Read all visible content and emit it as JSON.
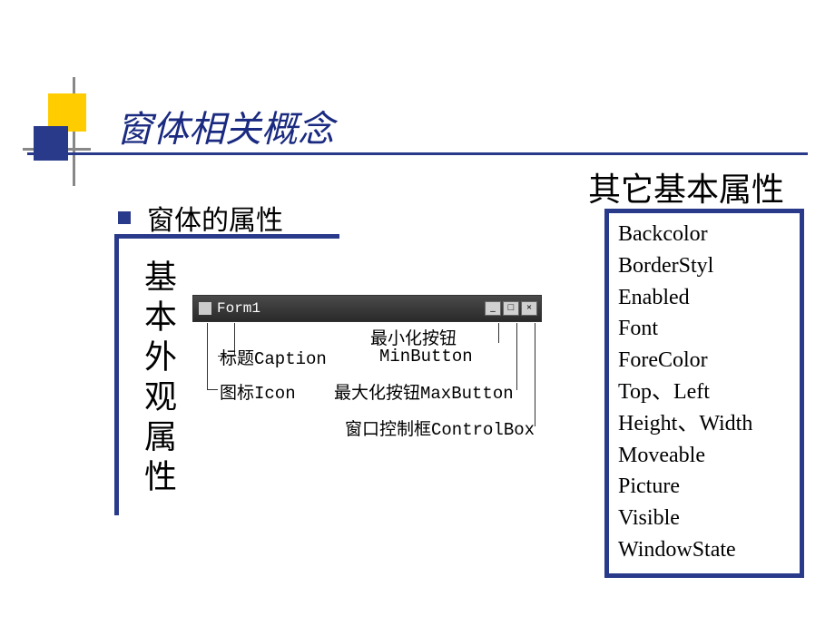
{
  "title": "窗体相关概念",
  "subtitle": "窗体的属性",
  "left_label": "基本外观属性",
  "form_window": {
    "title": "Form1",
    "min_glyph": "_",
    "max_glyph": "□",
    "close_glyph": "×"
  },
  "annotations": {
    "caption": "标题Caption",
    "icon": "图标Icon",
    "min_cn": "最小化按钮",
    "min_en": "MinButton",
    "max": "最大化按钮MaxButton",
    "controlbox": "窗口控制框ControlBox"
  },
  "right_heading": "其它基本属性",
  "properties": [
    "Backcolor",
    "BorderStyl",
    "Enabled",
    "Font",
    "ForeColor",
    "Top、Left",
    "Height、Width",
    "Moveable",
    "Picture",
    "Visible",
    "WindowState"
  ]
}
